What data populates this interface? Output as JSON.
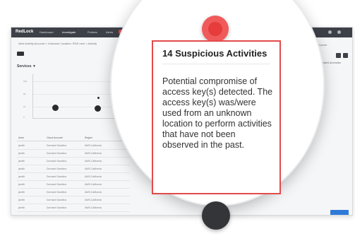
{
  "app": {
    "brand": "RedLock",
    "nav": [
      "Dashboard",
      "Investigate",
      "Policies",
      "Alerts"
    ],
    "alerts_badge": "new"
  },
  "breadcrumb": "Alert Activity Account > Unknown Location: RDS user > Activity",
  "section": {
    "title": "Services ▼",
    "y_ticks": [
      "100",
      "50",
      "10",
      "0"
    ]
  },
  "table": {
    "headers": [
      "Actor",
      "Cloud Account",
      "Region"
    ],
    "rows": [
      [
        "jsmith",
        "Dormant Sandbox",
        "AWS-California"
      ],
      [
        "jsmith",
        "Dormant Sandbox",
        "AWS-California"
      ],
      [
        "jsmith",
        "Dormant Sandbox",
        "AWS-California"
      ],
      [
        "jsmith",
        "Dormant Sandbox",
        "AWS-California"
      ],
      [
        "jsmith",
        "Dormant Sandbox",
        "AWS-California"
      ],
      [
        "jsmith",
        "Dormant Sandbox",
        "AWS-California"
      ],
      [
        "jsmith",
        "Dormant Sandbox",
        "AWS-California"
      ],
      [
        "jsmith",
        "Dormant Sandbox",
        "AWS-California"
      ],
      [
        "jsmith",
        "Dormant Sandbox",
        "AWS-California"
      ]
    ]
  },
  "right_panel": {
    "date_range": "Jun 2017 - Current",
    "label": "Related Anomalies",
    "button_label": "Go to Alerts"
  },
  "tooltip": {
    "title": "14 Suspicious Activities",
    "body": "Potential compromise of access key(s) detected. The access key(s) was/were used from an unknown location to perform activities that have not been observed in the past."
  },
  "colors": {
    "accent_red": "#e34a4a",
    "nav_dark": "#3d4147",
    "marker_dark": "#333538",
    "action_blue": "#2f7ad8"
  }
}
